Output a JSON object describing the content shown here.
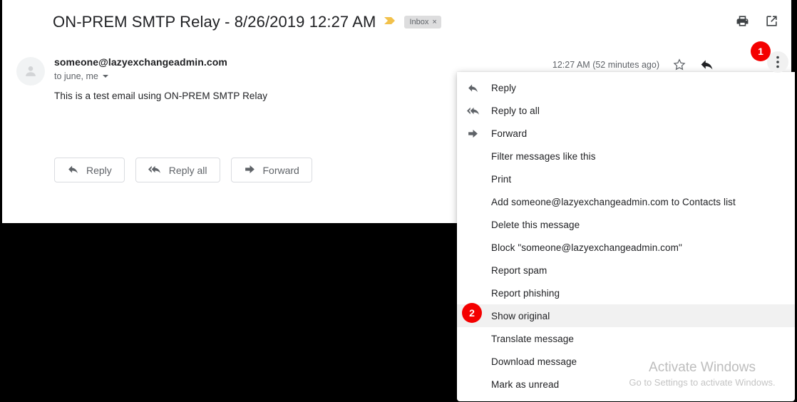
{
  "email": {
    "subject": "ON-PREM SMTP Relay - 8/26/2019 12:27 AM",
    "importance_marker_icon": "importance-marker-icon",
    "label": {
      "name": "Inbox",
      "remove": "×"
    },
    "header_actions": [
      {
        "icon": "print-icon",
        "name": "print-button"
      },
      {
        "icon": "open-in-new-icon",
        "name": "open-in-new-window-button"
      }
    ],
    "avatar_icon": "person-avatar-icon",
    "sender": "someone@lazyexchangeadmin.com",
    "recipients": "to june, me",
    "recipients_caret_icon": "chevron-down-icon",
    "body": "This is a test email using ON-PREM SMTP Relay",
    "timestamp": "12:27 AM (52 minutes ago)",
    "star_icon": "star-outline-icon",
    "reply_icon": "reply-arrow-icon",
    "more_icon": "more-vertical-icon",
    "action_buttons": [
      {
        "label": "Reply",
        "icon": "reply-arrow-icon"
      },
      {
        "label": "Reply all",
        "icon": "reply-all-arrow-icon"
      },
      {
        "label": "Forward",
        "icon": "forward-arrow-icon"
      }
    ]
  },
  "menu": {
    "items": [
      {
        "label": "Reply",
        "icon": "reply-arrow-icon",
        "highlighted": false
      },
      {
        "label": "Reply to all",
        "icon": "reply-all-arrow-icon",
        "highlighted": false
      },
      {
        "label": "Forward",
        "icon": "forward-arrow-icon",
        "highlighted": false
      },
      {
        "label": "Filter messages like this",
        "icon": "",
        "highlighted": false
      },
      {
        "label": "Print",
        "icon": "",
        "highlighted": false
      },
      {
        "label": "Add someone@lazyexchangeadmin.com to Contacts list",
        "icon": "",
        "highlighted": false
      },
      {
        "label": "Delete this message",
        "icon": "",
        "highlighted": false
      },
      {
        "label": "Block \"someone@lazyexchangeadmin.com\"",
        "icon": "",
        "highlighted": false
      },
      {
        "label": "Report spam",
        "icon": "",
        "highlighted": false
      },
      {
        "label": "Report phishing",
        "icon": "",
        "highlighted": false
      },
      {
        "label": "Show original",
        "icon": "",
        "highlighted": true
      },
      {
        "label": "Translate message",
        "icon": "",
        "highlighted": false
      },
      {
        "label": "Download message",
        "icon": "",
        "highlighted": false
      },
      {
        "label": "Mark as unread",
        "icon": "",
        "highlighted": false
      }
    ]
  },
  "badges": [
    {
      "number": "1",
      "id": "badge-1"
    },
    {
      "number": "2",
      "id": "badge-2"
    }
  ],
  "watermark": {
    "title": "Activate Windows",
    "subtitle": "Go to Settings to activate Windows."
  },
  "colors": {
    "badge_red": "#f40000",
    "importance_yellow": "#f2c14b",
    "text_primary": "#202124",
    "text_secondary": "#5f6368",
    "highlight_row": "#f1f1f1"
  }
}
